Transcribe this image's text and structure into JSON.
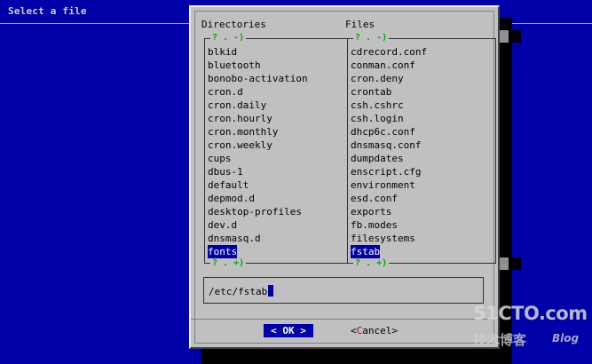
{
  "backtitle": "Select a file",
  "dialog": {
    "directories_heading": "Directories",
    "files_heading": "Files",
    "dir_scroll_top": "? . -)",
    "files_scroll_top": "? . -)",
    "dir_scroll_bottom": "? . +)",
    "files_scroll_bottom": "? . +)",
    "directories": [
      "blkid",
      "bluetooth",
      "bonobo-activation",
      "cron.d",
      "cron.daily",
      "cron.hourly",
      "cron.monthly",
      "cron.weekly",
      "cups",
      "dbus-1",
      "default",
      "depmod.d",
      "desktop-profiles",
      "dev.d",
      "dnsmasq.d",
      "fonts"
    ],
    "files": [
      "cdrecord.conf",
      "conman.conf",
      "cron.deny",
      "crontab",
      "csh.cshrc",
      "csh.login",
      "dhcp6c.conf",
      "dnsmasq.conf",
      "dumpdates",
      "enscript.cfg",
      "environment",
      "esd.conf",
      "exports",
      "fb.modes",
      "filesystems",
      "fstab"
    ],
    "selected_directory": "fonts",
    "selected_file": "fstab",
    "path_value": "/etc/fstab",
    "ok_label": "OK",
    "cancel_prefix": "<",
    "cancel_hotkey": "C",
    "cancel_rest": "ancel>"
  },
  "watermark": {
    "site": "51CTO.com",
    "sub": "技术博客",
    "blog": "Blog"
  },
  "colors": {
    "background": "#0000a8",
    "dialog": "#c0c0c0",
    "selection": "#0000a8",
    "scroll_indicator": "#00a800",
    "hotkey": "#c00000"
  }
}
